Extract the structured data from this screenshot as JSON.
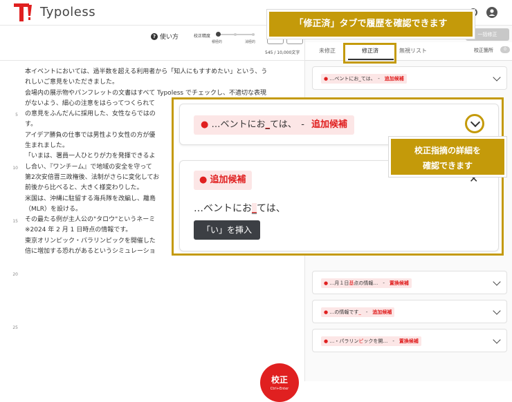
{
  "app": {
    "name": "Typoless"
  },
  "toolbar": {
    "help_label": "使い方",
    "precision_label": "校正精度",
    "precision_min": "積極的",
    "precision_max": "消極的",
    "counter": "545 / 10,000文字"
  },
  "editor": {
    "gutter_numbers": [
      "5",
      "10",
      "15",
      "20",
      "25"
    ],
    "lines": [
      "本イベントにおいては、過半数を超える利用者から「知人にもすすめたい」という、う",
      "れしいご意見をいただきました。",
      "会場内の展示物やパンフレットの文書はすべて Typoless でチェックし、不適切な表現",
      "がないよう、細心の注意をはらってつくられて",
      "の意見をふんだんに採用した、女性ならではの",
      "す。",
      "アイデア勝負の仕事では男性より女性の方が優",
      "生まれました。",
      "「いまは、署員一人ひとりが力を発揮できるよ",
      "し合い、『ワンチーム』で地域の安全を守って",
      "第2次安倍晋三政権後、法制がさらに変化してお",
      "前後から比べると、大きく様変わりした。",
      "米国は、沖縄に駐留する海兵隊を改編し、離島",
      "（MLR）を設ける。",
      "その最たる例が主人公の\"タロウ\"というネーミ",
      "※2024 年 2 月 1 日時点の情報です。",
      "東京オリンピック・パラリンピックを開催した",
      "倍に増加する恐れがあるというシミュレーショ"
    ]
  },
  "panel": {
    "pill": "限定",
    "fix_all_label": "一括修正",
    "tabs": [
      "未修正",
      "修正済",
      "無視リスト"
    ],
    "count_label": "校正箇所",
    "count": "0",
    "cards": [
      {
        "pre": "…ベントにお",
        "hl": "_",
        "post": "ては、",
        "sep": "-",
        "kind": "追加候補"
      },
      {
        "pre": "…月１日",
        "hl": "基",
        "post": "点の情報…",
        "sep": "-",
        "kind": "置換候補"
      },
      {
        "pre": "…の情報です",
        "hl": "_",
        "post": "",
        "sep": "-",
        "kind": "追加候補"
      },
      {
        "pre": "…・パラリン",
        "hl": "ピ",
        "post": "ックを開…",
        "sep": "-",
        "kind": "置換候補"
      }
    ]
  },
  "zoom": {
    "card_pre": "…ベントにお",
    "card_hl": "_",
    "card_post": "ては、",
    "card_sep": "-",
    "card_kind": "追加候補",
    "detail_kind": "追加候補",
    "snippet_pre": "…ベントにお",
    "snippet_hl": "_",
    "snippet_post": "ては、",
    "insert_label": "「い」を挿入"
  },
  "callouts": {
    "top": "「修正済」タブで履歴を確認できます",
    "right_line1": "校正指摘の詳細を",
    "right_line2": "確認できます"
  },
  "fab": {
    "label": "校正",
    "shortcut": "Ctrl+Enter"
  },
  "colors": {
    "accent": "#c49a0a",
    "error": "#e02020",
    "highlight_bg": "#fce6e6",
    "logo": "#e02020"
  }
}
